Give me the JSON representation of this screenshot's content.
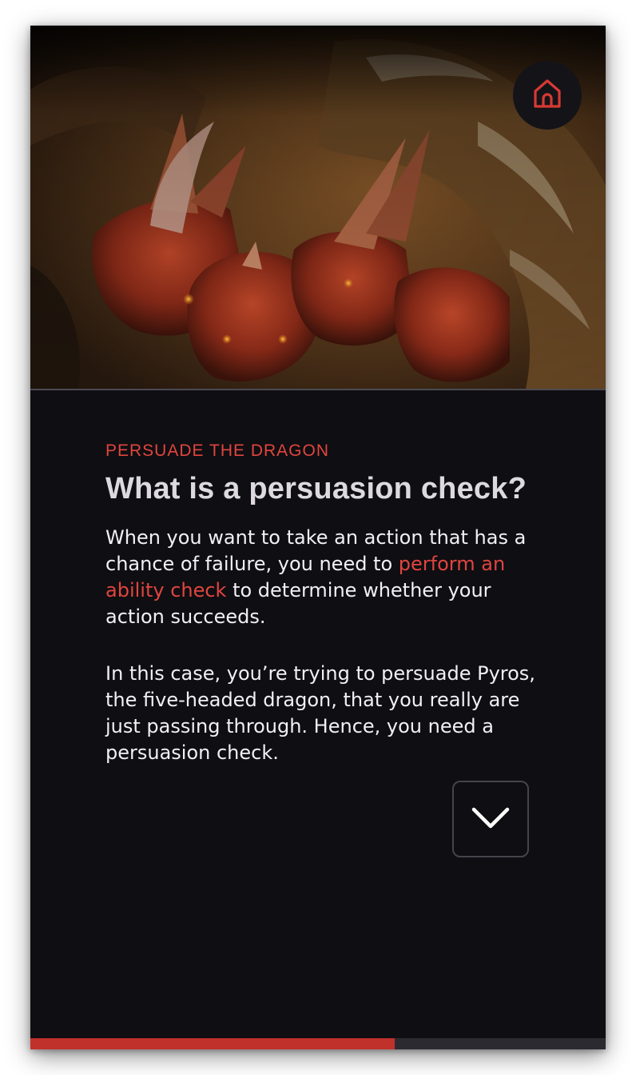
{
  "hero": {
    "image_subject": "five-headed red dragon illustration"
  },
  "header": {
    "home_icon": "home-icon"
  },
  "lesson": {
    "eyebrow": "PERSUADE THE DRAGON",
    "title": "What is a persuasion check?",
    "paragraph1": {
      "before_link": "When you want to take an action that has a chance of failure, you need to ",
      "link_text": "perform an ability check",
      "after_link": " to determine whether your action succeeds."
    },
    "paragraph2": "In this case, you’re trying to persuade Pyros, the five-headed dragon, that you really are just passing through. Hence, you need a persuasion check."
  },
  "navigation": {
    "next_icon": "chevron-down-icon"
  },
  "progress": {
    "fraction": 0.633
  },
  "colors": {
    "background": "#0f0e12",
    "accent": "#e0453f",
    "progress_fill": "#c0312c",
    "progress_track": "#2b2a31",
    "title": "#dcdae0",
    "body_text": "#f1f0f3"
  }
}
